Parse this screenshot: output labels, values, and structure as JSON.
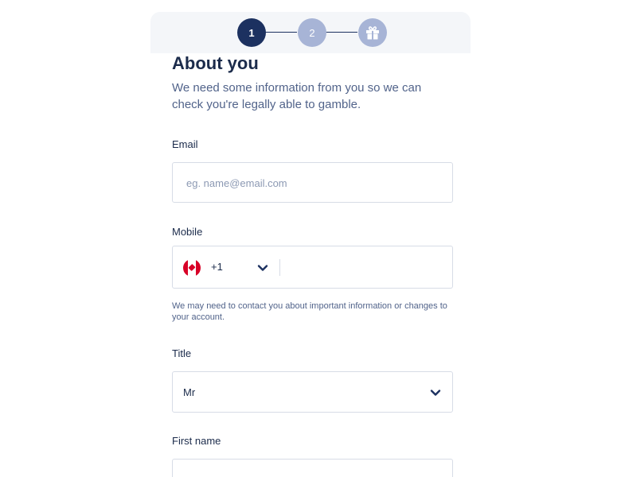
{
  "stepper": {
    "steps": [
      {
        "label": "1",
        "state": "active"
      },
      {
        "label": "2",
        "state": "inactive"
      },
      {
        "icon": "gift-icon",
        "state": "inactive"
      }
    ],
    "colors": {
      "active": "#1c3160",
      "inactive": "#a7b4d6"
    }
  },
  "form": {
    "title": "About you",
    "subtitle": "We need some information from you so we can check you're legally able to gamble.",
    "email": {
      "label": "Email",
      "value": "",
      "placeholder": "eg. name@email.com"
    },
    "mobile": {
      "label": "Mobile",
      "flag_icon": "canada-flag-icon",
      "dial_code": "+1",
      "value": "",
      "helper": "We may need to contact you about important information or changes to your account."
    },
    "title_select": {
      "label": "Title",
      "value": "Mr"
    },
    "first_name": {
      "label": "First name",
      "value": ""
    }
  }
}
